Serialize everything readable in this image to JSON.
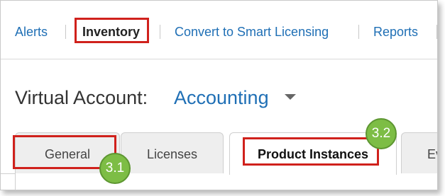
{
  "nav": {
    "items": [
      {
        "label": "Alerts",
        "active": false
      },
      {
        "label": "Inventory",
        "active": true
      },
      {
        "label": "Convert to Smart Licensing",
        "active": false
      },
      {
        "label": "Reports",
        "active": false
      }
    ]
  },
  "virtual_account": {
    "label": "Virtual Account:",
    "value": "Accounting"
  },
  "tabs": [
    {
      "label": "General",
      "selected": false
    },
    {
      "label": "Licenses",
      "selected": false
    },
    {
      "label": "Product Instances",
      "selected": true
    },
    {
      "label": "Ev",
      "selected": false
    }
  ],
  "annotations": {
    "step_31": "3.1",
    "step_32": "3.2"
  },
  "colors": {
    "link": "#1f6fb5",
    "highlight": "#d0211c",
    "badge": "#7dbd45"
  },
  "icons": {
    "account_dropdown": "caret-down-icon"
  }
}
